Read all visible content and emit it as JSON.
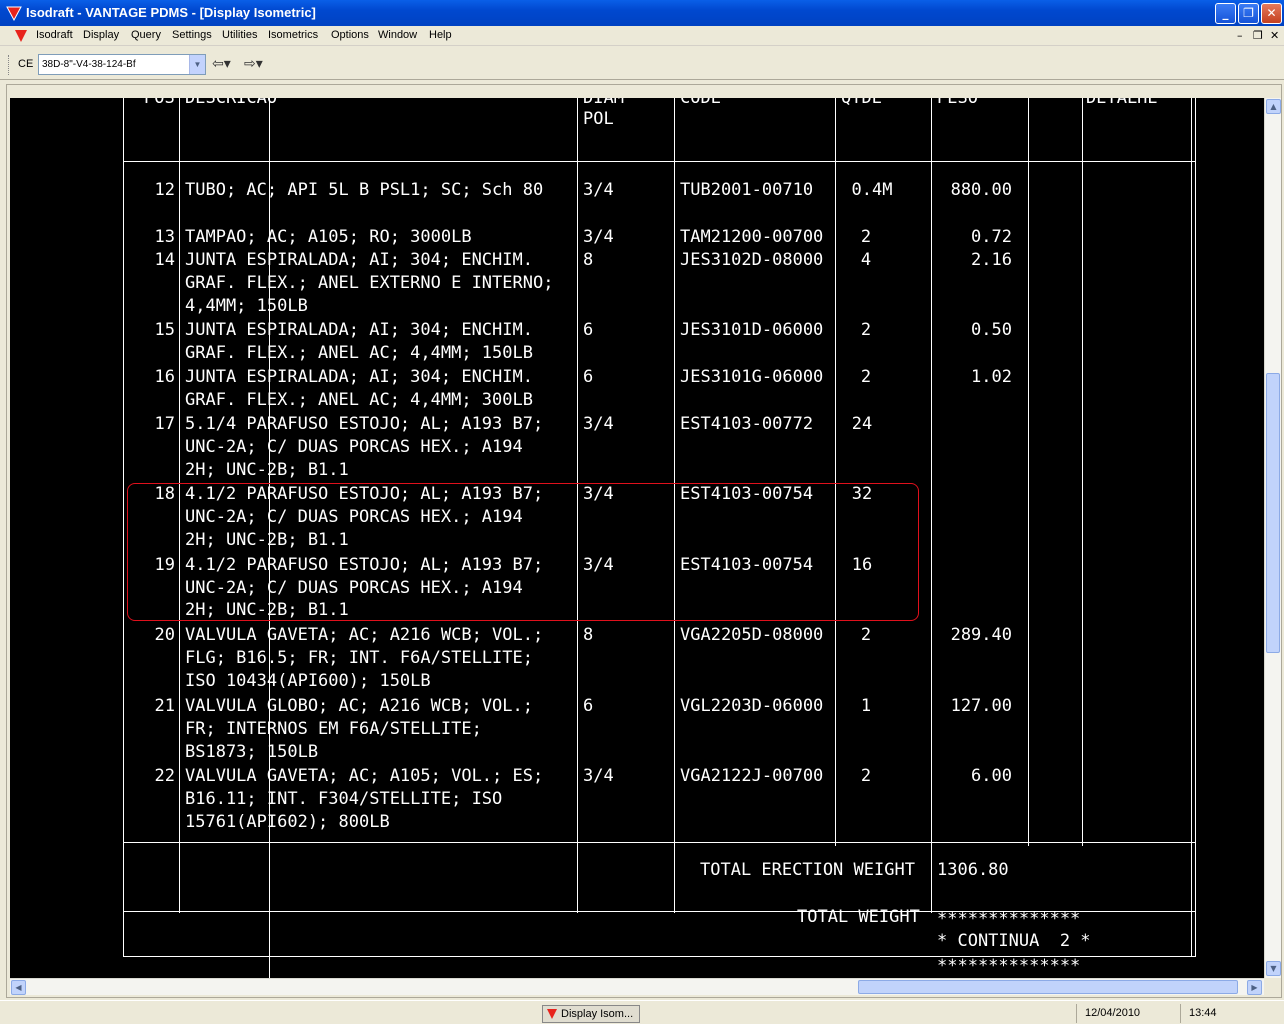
{
  "window": {
    "title": "Isodraft - VANTAGE PDMS - [Display Isometric]"
  },
  "menubar": [
    "Isodraft",
    "Display",
    "Query",
    "Settings",
    "Utilities",
    "Isometrics",
    "Options",
    "Window",
    "Help"
  ],
  "toolbar": {
    "ce_label": "CE",
    "ce_value": "38D-8\"-V4-38-124-Bf"
  },
  "drawing": {
    "header": {
      "pos": "POS",
      "descricao": "DESCRICAO",
      "diam1": "DIAM",
      "diam2": "POL",
      "code": "CODE",
      "qtde": "QTDE",
      "peso": "PESO",
      "detalhe": "DETALHE"
    },
    "rows": [
      {
        "pos": "12",
        "desc": [
          "TUBO; AC; API 5L B PSL1; SC; Sch 80"
        ],
        "diam": "3/4",
        "code": "TUB2001-00710",
        "qtde": "0.4M",
        "peso": "880.00"
      },
      {
        "pos": "13",
        "desc": [
          "TAMPAO; AC; A105; RO; 3000LB"
        ],
        "diam": "3/4",
        "code": "TAM21200-00700",
        "qtde": "2",
        "peso": "0.72"
      },
      {
        "pos": "14",
        "desc": [
          "JUNTA ESPIRALADA; AI; 304; ENCHIM.",
          "GRAF. FLEX.; ANEL EXTERNO E INTERNO;",
          "4,4MM; 150LB"
        ],
        "diam": "8",
        "code": "JES3102D-08000",
        "qtde": "4",
        "peso": "2.16"
      },
      {
        "pos": "15",
        "desc": [
          "JUNTA ESPIRALADA; AI; 304; ENCHIM.",
          "GRAF. FLEX.; ANEL AC; 4,4MM; 150LB"
        ],
        "diam": "6",
        "code": "JES3101D-06000",
        "qtde": "2",
        "peso": "0.50"
      },
      {
        "pos": "16",
        "desc": [
          "JUNTA ESPIRALADA; AI; 304; ENCHIM.",
          "GRAF. FLEX.; ANEL AC; 4,4MM; 300LB"
        ],
        "diam": "6",
        "code": "JES3101G-06000",
        "qtde": "2",
        "peso": "1.02"
      },
      {
        "pos": "17",
        "desc": [
          "5.1/4 PARAFUSO ESTOJO; AL; A193 B7;",
          "UNC-2A; C/ DUAS PORCAS HEX.; A194",
          "2H; UNC-2B; B1.1"
        ],
        "diam": "3/4",
        "code": "EST4103-00772",
        "qtde": "24",
        "peso": ""
      },
      {
        "pos": "18",
        "desc": [
          "4.1/2 PARAFUSO ESTOJO; AL; A193 B7;",
          "UNC-2A; C/ DUAS PORCAS HEX.; A194",
          "2H; UNC-2B; B1.1"
        ],
        "diam": "3/4",
        "code": "EST4103-00754",
        "qtde": "32",
        "peso": ""
      },
      {
        "pos": "19",
        "desc": [
          "4.1/2 PARAFUSO ESTOJO; AL; A193 B7;",
          "UNC-2A; C/ DUAS PORCAS HEX.; A194",
          "2H; UNC-2B; B1.1"
        ],
        "diam": "3/4",
        "code": "EST4103-00754",
        "qtde": "16",
        "peso": ""
      },
      {
        "pos": "20",
        "desc": [
          "VALVULA GAVETA; AC; A216 WCB; VOL.;",
          "FLG; B16.5; FR; INT. F6A/STELLITE;",
          "ISO 10434(API600); 150LB"
        ],
        "diam": "8",
        "code": "VGA2205D-08000",
        "qtde": "2",
        "peso": "289.40"
      },
      {
        "pos": "21",
        "desc": [
          "VALVULA GLOBO; AC; A216 WCB; VOL.;",
          "FR; INTERNOS EM F6A/STELLITE;",
          "BS1873; 150LB"
        ],
        "diam": "6",
        "code": "VGL2203D-06000",
        "qtde": "1",
        "peso": "127.00"
      },
      {
        "pos": "22",
        "desc": [
          "VALVULA GAVETA; AC; A105; VOL.; ES;",
          "B16.11; INT. F304/STELLITE; ISO",
          "15761(API602); 800LB"
        ],
        "diam": "3/4",
        "code": "VGA2122J-00700",
        "qtde": "2",
        "peso": "6.00"
      }
    ],
    "total_erection_label": "TOTAL ERECTION WEIGHT",
    "total_erection_value": "1306.80",
    "total_weight_label": "TOTAL WEIGHT",
    "stars": "**************",
    "continua": "* CONTINUA  2 *"
  },
  "status": {
    "task_label": "Display Isom...",
    "date": "12/04/2010",
    "time": "13:44"
  }
}
